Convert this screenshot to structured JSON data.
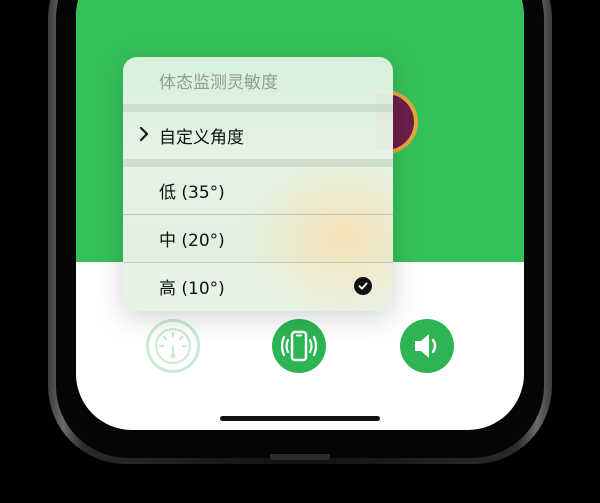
{
  "menu": {
    "header": "体态监测灵敏度",
    "submenu_label": "自定义角度",
    "options": [
      {
        "label": "低 (35°)",
        "selected": false
      },
      {
        "label": "中 (20°)",
        "selected": false
      },
      {
        "label": "高 (10°)",
        "selected": true
      }
    ]
  },
  "toolbar": {
    "buttons": [
      {
        "icon": "gauge-icon",
        "state": "dimmed"
      },
      {
        "icon": "phone-vibrate-icon",
        "state": "active"
      },
      {
        "icon": "speaker-icon",
        "state": "active"
      }
    ]
  },
  "colors": {
    "green": "#35c15a",
    "button_green": "#2cb552"
  }
}
